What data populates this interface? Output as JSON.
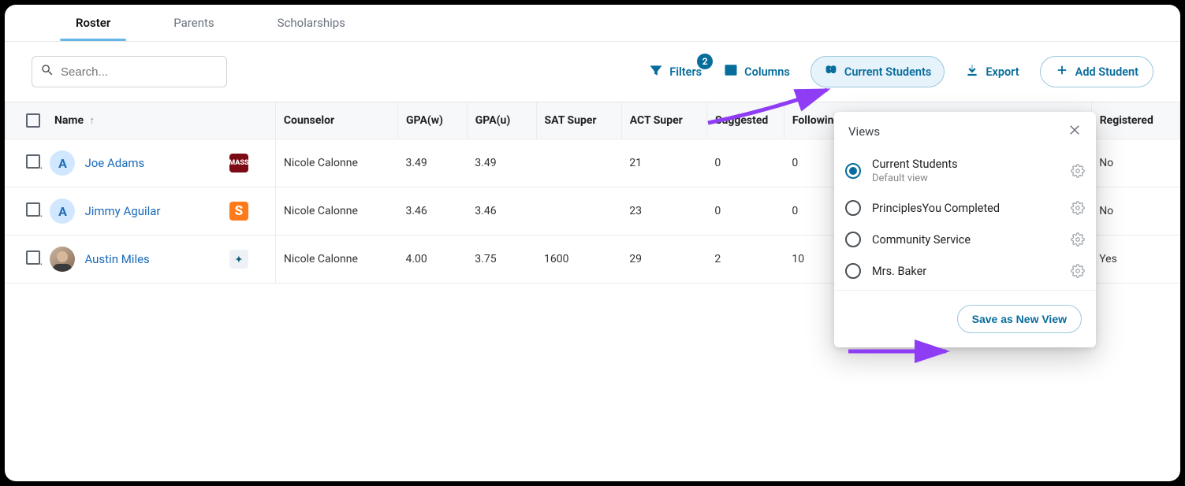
{
  "tabs": {
    "roster": "Roster",
    "parents": "Parents",
    "scholarships": "Scholarships"
  },
  "search": {
    "placeholder": "Search..."
  },
  "toolbar": {
    "filters": {
      "label": "Filters",
      "badge": "2"
    },
    "columns": "Columns",
    "currentView": "Current Students",
    "export": "Export",
    "addStudent": "Add Student"
  },
  "columns": {
    "name": "Name",
    "counselor": "Counselor",
    "gpaw": "GPA(w)",
    "gpau": "GPA(u)",
    "sat": "SAT Super",
    "act": "ACT Super",
    "suggested": "Suggested",
    "following": "Following",
    "registered": "Registered"
  },
  "rows": [
    {
      "avatarType": "letter",
      "avatarText": "A",
      "name": "Joe Adams",
      "counselor": "Nicole Calonne",
      "gpaw": "3.49",
      "gpau": "3.49",
      "sat": "",
      "act": "21",
      "suggested": "0",
      "following": "0",
      "registered": "No"
    },
    {
      "avatarType": "letter",
      "avatarText": "A",
      "name": "Jimmy Aguilar",
      "counselor": "Nicole Calonne",
      "gpaw": "3.46",
      "gpau": "3.46",
      "sat": "",
      "act": "23",
      "suggested": "0",
      "following": "0",
      "registered": "No"
    },
    {
      "avatarType": "img",
      "avatarText": "",
      "name": "Austin Miles",
      "counselor": "Nicole Calonne",
      "gpaw": "4.00",
      "gpau": "3.75",
      "sat": "1600",
      "act": "29",
      "suggested": "2",
      "following": "10",
      "registered": "Yes"
    }
  ],
  "rowBadges": [
    "MASS",
    "S",
    "✦"
  ],
  "viewsPanel": {
    "title": "Views",
    "items": [
      {
        "name": "Current Students",
        "sub": "Default view",
        "selected": true
      },
      {
        "name": "PrinciplesYou Completed",
        "selected": false
      },
      {
        "name": "Community Service",
        "selected": false
      },
      {
        "name": "Mrs. Baker",
        "selected": false
      }
    ],
    "save": "Save as New View"
  }
}
